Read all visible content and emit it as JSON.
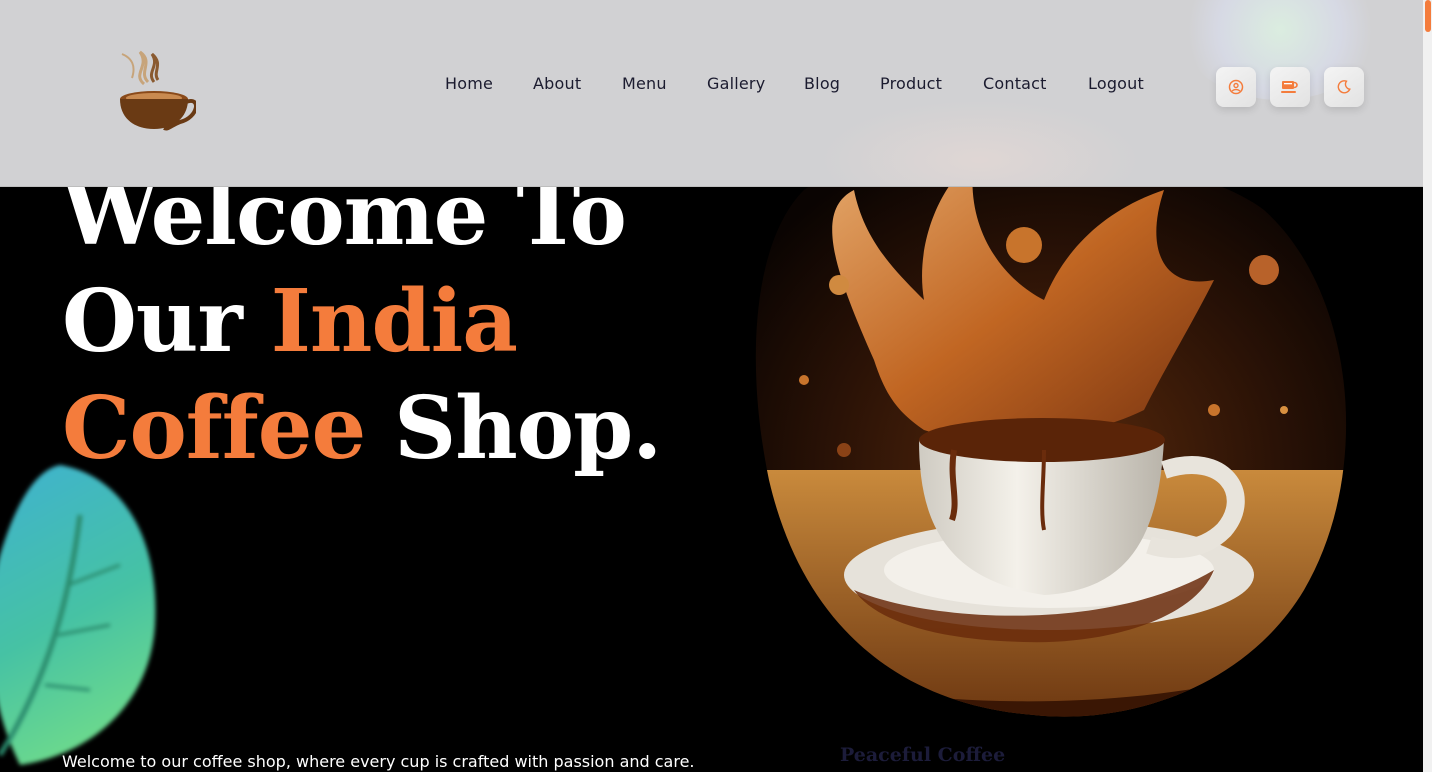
{
  "nav": {
    "items": [
      {
        "label": "Home"
      },
      {
        "label": "About"
      },
      {
        "label": "Menu"
      },
      {
        "label": "Gallery"
      },
      {
        "label": "Blog"
      },
      {
        "label": "Product"
      },
      {
        "label": "Contact"
      },
      {
        "label": "Logout"
      }
    ]
  },
  "header_icons": [
    "user-circle-icon",
    "coffee-cup-icon",
    "moon-icon"
  ],
  "hero": {
    "line1": "Welcome To",
    "line2_plain": "Our ",
    "line2_accent": "India",
    "line3_accent": "Coffee",
    "line3_plain": " Shop.",
    "tagline": "Welcome to our coffee shop, where every cup is crafted with passion and care.",
    "peeking_heading": "Peaceful Coffee"
  },
  "colors": {
    "accent": "#f47c3c",
    "background": "#000000",
    "header": "#d1d1d3",
    "nav_text": "#1b1b2f"
  }
}
